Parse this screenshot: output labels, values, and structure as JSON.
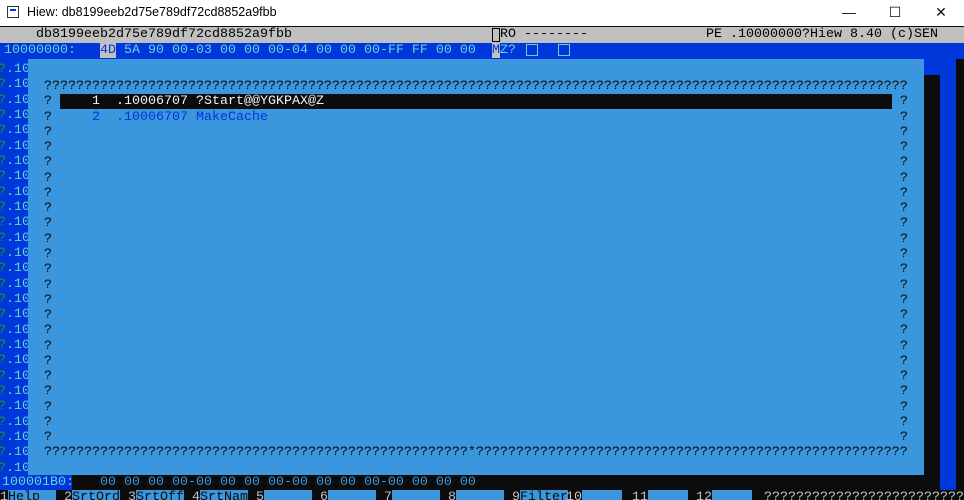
{
  "window": {
    "title": "Hiew: db8199eeb2d75e789df72cd8852a9fbb",
    "minimize": "—",
    "maximize": "☐",
    "close": "✕"
  },
  "header": {
    "filename": "db8199eeb2d75e789df72cd8852a9fbb",
    "mode": "RO --------",
    "info": "PE .10000000?Hiew 8.40 (c)SEN"
  },
  "hexrow": {
    "address": "10000000:",
    "cursor_byte": "4D",
    "bytes": "5A 90 00-03 00 00 00-04 00 00 00-FF FF 00 00",
    "ascii_cursor": "M",
    "ascii": "Z?"
  },
  "left_strip": {
    "prefix": "?",
    "label": ".10",
    "count": 27
  },
  "popup": {
    "top_border": "????????????????????????????????????????????????????????????????????????????????????????????????????????????",
    "bottom_border": "?????????????????????????????????????????????????????*??????????????????????????????????????????????????????",
    "side_char": "?",
    "side_rows": 23,
    "items": [
      {
        "num": "1",
        "address": ".10006707",
        "name": "?Start@@YGKPAX@Z",
        "selected": true
      },
      {
        "num": "2",
        "address": ".10006707",
        "name": "MakeCache",
        "selected": false
      }
    ]
  },
  "bottom_hex": {
    "address": "100001B0:",
    "bytes": "00 00 00 00-00 00 00 00-00 00 00 00-00 00 00 00"
  },
  "fkeys": [
    {
      "key": "1",
      "label": "Help"
    },
    {
      "key": "2",
      "label": "SrtOrd"
    },
    {
      "key": "3",
      "label": "SrtOff"
    },
    {
      "key": "4",
      "label": "SrtNam"
    },
    {
      "key": "5",
      "label": ""
    },
    {
      "key": "6",
      "label": ""
    },
    {
      "key": "7",
      "label": ""
    },
    {
      "key": "8",
      "label": ""
    },
    {
      "key": "9",
      "label": "Filter"
    },
    {
      "key": "10",
      "label": ""
    },
    {
      "key": "11",
      "label": ""
    },
    {
      "key": "12",
      "label": ""
    }
  ],
  "fkeys_tail": "??????????????????????????",
  "colors": {
    "dark_blue": "#0037da",
    "light_blue": "#3a96dd",
    "cyan": "#61d6d6",
    "gray": "#c0c0c0"
  }
}
